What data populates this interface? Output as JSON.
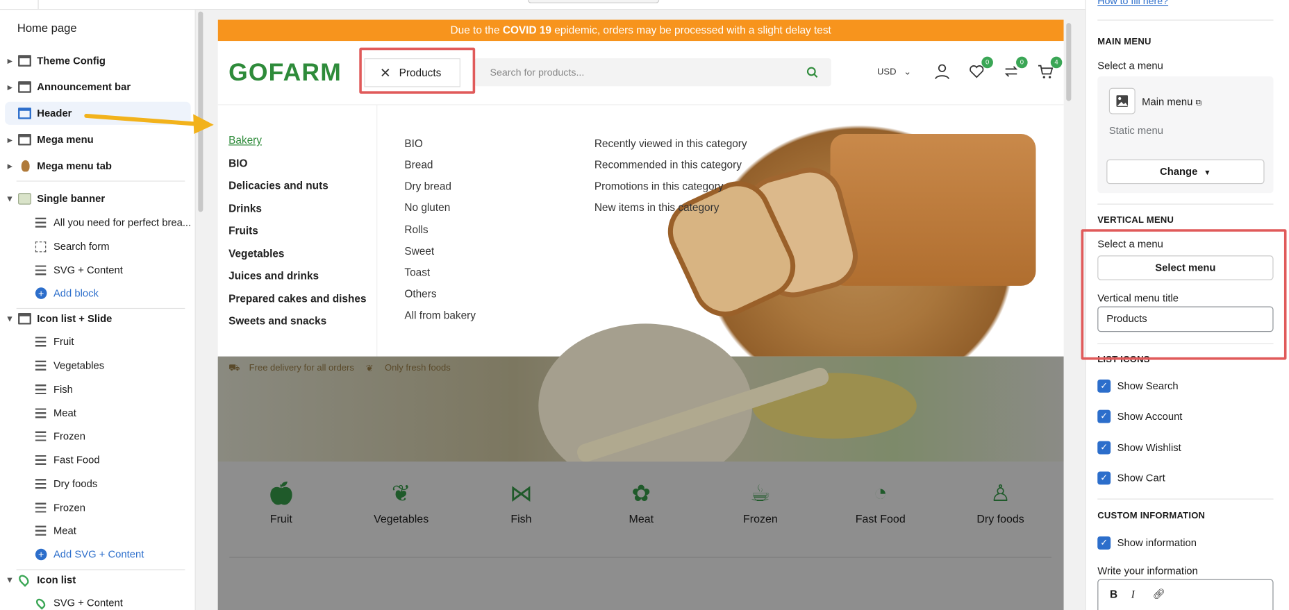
{
  "sidebar": {
    "title": "Home page",
    "items": [
      {
        "label": "Theme Config"
      },
      {
        "label": "Announcement bar"
      },
      {
        "label": "Header"
      },
      {
        "label": "Mega menu"
      },
      {
        "label": "Mega menu tab"
      },
      {
        "label": "Single banner"
      },
      {
        "label": "All you need for perfect brea..."
      },
      {
        "label": "Search form"
      },
      {
        "label": "SVG + Content"
      },
      {
        "label": "Add block"
      },
      {
        "label": "Icon list + Slide"
      },
      {
        "label": "Fruit"
      },
      {
        "label": "Vegetables"
      },
      {
        "label": "Fish"
      },
      {
        "label": "Meat"
      },
      {
        "label": "Frozen"
      },
      {
        "label": "Fast Food"
      },
      {
        "label": "Dry foods"
      },
      {
        "label": "Frozen"
      },
      {
        "label": "Meat"
      },
      {
        "label": "Add SVG + Content"
      },
      {
        "label": "Icon list"
      },
      {
        "label": "SVG + Content"
      }
    ]
  },
  "preview": {
    "announcement_pre": "Due to the ",
    "announcement_bold": "COVID 19",
    "announcement_post": " epidemic, orders may be processed with a slight delay test",
    "logo": "GOFARM",
    "products_button": "Products",
    "search_placeholder": "Search for products...",
    "currency": "USD",
    "wishlist_count": "0",
    "compare_count": "0",
    "cart_count": "4",
    "menu_col1": [
      "Bakery",
      "BIO",
      "Delicacies and nuts",
      "Drinks",
      "Fruits",
      "Vegetables",
      "Juices and drinks",
      "Prepared cakes and dishes",
      "Sweets and snacks"
    ],
    "menu_col2": [
      "BIO",
      "Bread",
      "Dry bread",
      "No gluten",
      "Rolls",
      "Sweet",
      "Toast",
      "Others",
      "All from bakery"
    ],
    "menu_col3": [
      "Recently viewed in this category",
      "Recommended in this category",
      "Promotions in this category",
      "New items in this category"
    ],
    "feature1": "Free delivery for all orders",
    "feature2": "Only fresh foods",
    "categories": [
      "Fruit",
      "Vegetables",
      "Fish",
      "Meat",
      "Frozen",
      "Fast Food",
      "Dry foods"
    ]
  },
  "panel": {
    "link": "How to fill here?",
    "main_menu_heading": "MAIN MENU",
    "select_menu_label": "Select a menu",
    "main_menu_name": "Main menu",
    "static_menu": "Static menu",
    "change_button": "Change",
    "vertical_menu_heading": "VERTICAL MENU",
    "vertical_select_label": "Select a menu",
    "select_menu_button": "Select menu",
    "vertical_title_label": "Vertical menu title",
    "vertical_title_value": "Products",
    "list_icons_heading": "LIST ICONS",
    "show_search": "Show Search",
    "show_account": "Show Account",
    "show_wishlist": "Show Wishlist",
    "show_cart": "Show Cart",
    "custom_info_heading": "CUSTOM INFORMATION",
    "show_information": "Show information",
    "write_info_label": "Write your information"
  },
  "colors": {
    "accent": "#2c6ecb",
    "brand_green": "#2e8b3a",
    "announce": "#f7941d",
    "highlight": "#e05a5a",
    "arrow": "#f2b21b"
  }
}
